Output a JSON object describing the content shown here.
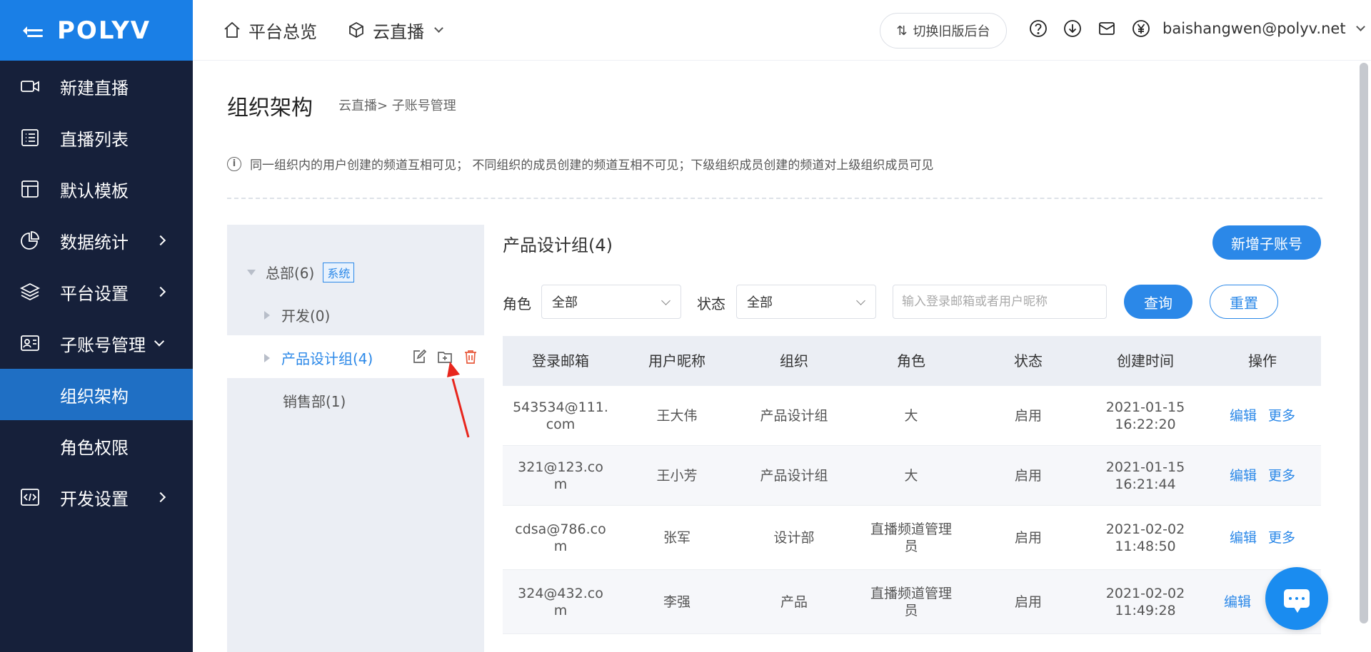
{
  "logo": "POLYV",
  "sidebar": {
    "items": [
      {
        "label": "新建直播"
      },
      {
        "label": "直播列表"
      },
      {
        "label": "默认模板"
      },
      {
        "label": "数据统计"
      },
      {
        "label": "平台设置"
      },
      {
        "label": "子账号管理"
      },
      {
        "label": "组织架构"
      },
      {
        "label": "角色权限"
      },
      {
        "label": "开发设置"
      }
    ]
  },
  "header": {
    "overview": "平台总览",
    "product": "云直播",
    "switch_label": "切换旧版后台",
    "user_email": "baishangwen@polyv.net"
  },
  "page": {
    "title": "组织架构",
    "breadcrumb": "云直播>  子账号管理",
    "notice": "同一组织内的用户创建的频道互相可见；  不同组织的成员创建的频道互相不可见；下级组织成员创建的频道对上级组织成员可见"
  },
  "tree": {
    "root": "总部(6)",
    "root_badge": "系统",
    "children": [
      "开发(0)",
      "产品设计组(4)",
      "销售部(1)"
    ]
  },
  "content": {
    "group_title": "产品设计组(4)",
    "add_button": "新增子账号",
    "role_label": "角色",
    "role_value": "全部",
    "status_label": "状态",
    "status_value": "全部",
    "search_placeholder": "输入登录邮箱或者用户昵称",
    "query_button": "查询",
    "reset_button": "重置"
  },
  "table": {
    "columns": [
      "登录邮箱",
      "用户昵称",
      "组织",
      "角色",
      "状态",
      "创建时间",
      "操作"
    ],
    "rows": [
      {
        "email": "543534@111.com",
        "email_l1": "543534@111.",
        "email_l2": "com",
        "nickname": "王大伟",
        "org": "产品设计组",
        "role_l1": "大",
        "role_l2": "",
        "status": "启用",
        "date": "2021-01-15",
        "time": "16:22:20",
        "edit": "编辑",
        "more": "更多"
      },
      {
        "email": "321@123.com",
        "email_l1": "321@123.co",
        "email_l2": "m",
        "nickname": "王小芳",
        "org": "产品设计组",
        "role_l1": "大",
        "role_l2": "",
        "status": "启用",
        "date": "2021-01-15",
        "time": "16:21:44",
        "edit": "编辑",
        "more": "更多"
      },
      {
        "email": "cdsa@786.com",
        "email_l1": "cdsa@786.co",
        "email_l2": "m",
        "nickname": "张军",
        "org": "设计部",
        "role_l1": "直播频道管理",
        "role_l2": "员",
        "status": "启用",
        "date": "2021-02-02",
        "time": "11:48:50",
        "edit": "编辑",
        "more": "更多"
      },
      {
        "email": "324@432.com",
        "email_l1": "324@432.co",
        "email_l2": "m",
        "nickname": "李强",
        "org": "产品",
        "role_l1": "直播频道管理",
        "role_l2": "员",
        "status": "启用",
        "date": "2021-02-02",
        "time": "11:49:28",
        "edit": "编辑",
        "more": ""
      }
    ]
  },
  "colors": {
    "brand": "#1a7fe6",
    "sidebar_bg": "#16203a",
    "active_item": "#1f6fc4",
    "link": "#2b88e8",
    "delete_icon": "#e85a3c",
    "annotation_arrow": "#e8261d"
  }
}
